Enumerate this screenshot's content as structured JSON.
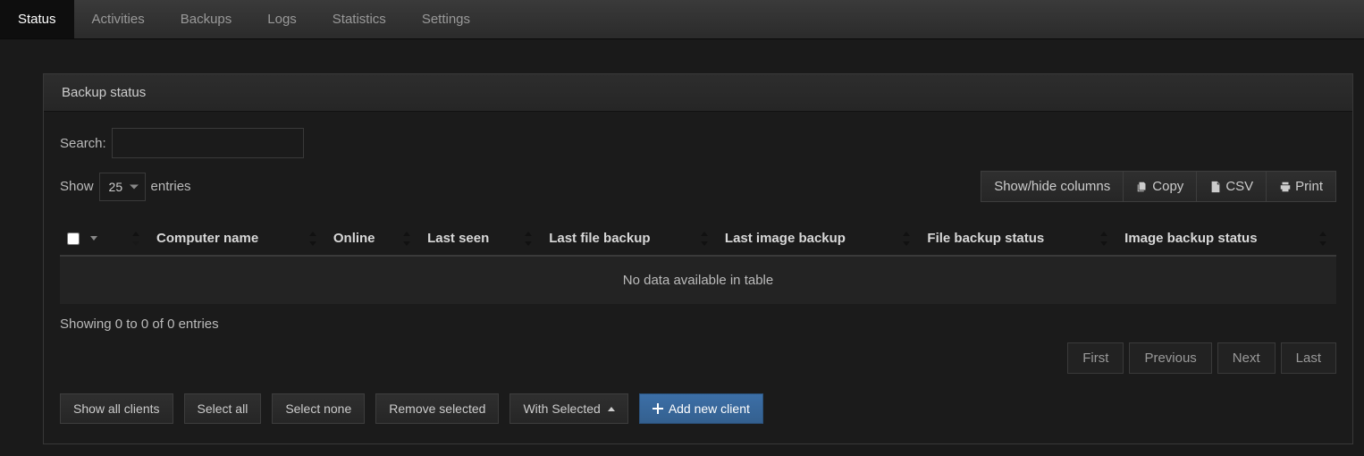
{
  "nav": {
    "items": [
      {
        "label": "Status",
        "active": true
      },
      {
        "label": "Activities"
      },
      {
        "label": "Backups"
      },
      {
        "label": "Logs"
      },
      {
        "label": "Statistics"
      },
      {
        "label": "Settings"
      }
    ]
  },
  "panel": {
    "title": "Backup status"
  },
  "search": {
    "label": "Search:"
  },
  "length": {
    "show": "Show",
    "entries": "entries",
    "value": "25"
  },
  "toolbar": {
    "show_hide": "Show/hide columns",
    "copy": "Copy",
    "csv": "CSV",
    "print": "Print"
  },
  "columns": {
    "computer_name": "Computer name",
    "online": "Online",
    "last_seen": "Last seen",
    "last_file_backup": "Last file backup",
    "last_image_backup": "Last image backup",
    "file_backup_status": "File backup status",
    "image_backup_status": "Image backup status"
  },
  "table": {
    "empty": "No data available in table"
  },
  "info": "Showing 0 to 0 of 0 entries",
  "pagination": {
    "first": "First",
    "previous": "Previous",
    "next": "Next",
    "last": "Last"
  },
  "actions": {
    "show_all": "Show all clients",
    "select_all": "Select all",
    "select_none": "Select none",
    "remove_selected": "Remove selected",
    "with_selected": "With Selected",
    "add_new": "Add new client"
  }
}
